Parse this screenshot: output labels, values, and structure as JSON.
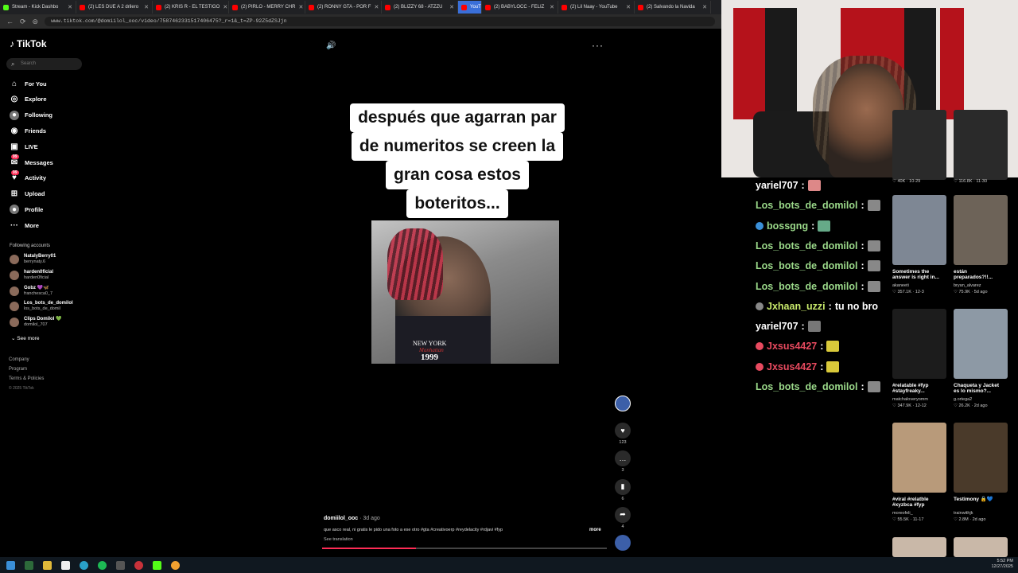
{
  "browser": {
    "tabs": [
      {
        "label": "Stream - Kick Dashbo",
        "color": "#53fc18"
      },
      {
        "label": "(2) LES DUE A 2 drilero",
        "color": "#ff0000"
      },
      {
        "label": "(2) KRIS R - EL TESTIGO",
        "color": "#ff0000"
      },
      {
        "label": "(2) PIRLO - MERRY CHR",
        "color": "#ff0000"
      },
      {
        "label": "(2) RONNY GTA - POR F",
        "color": "#ff0000"
      },
      {
        "label": "(2) BLIZZY 68 - ATZZU",
        "color": "#ff0000"
      },
      {
        "label": "YouTube",
        "color": "#ff0000"
      },
      {
        "label": "(2) BABYLOCC - FELIZ",
        "color": "#ff0000"
      },
      {
        "label": "(2) Lil Naay - YouTube",
        "color": "#ff0000"
      },
      {
        "label": "(2) Salvando la Navida",
        "color": "#ff0000"
      }
    ],
    "url": "www.tiktok.com/@domiilol_ooc/video/7587462331517406475?_r=1&_t=ZP-92Z5dZSJjn"
  },
  "tiktok": {
    "logo": "TikTok",
    "search_placeholder": "Search",
    "nav": [
      {
        "label": "For You",
        "icon": "home-icon"
      },
      {
        "label": "Explore",
        "icon": "compass-icon"
      },
      {
        "label": "Following",
        "icon": "following-icon"
      },
      {
        "label": "Friends",
        "icon": "friends-icon"
      },
      {
        "label": "LIVE",
        "icon": "live-icon"
      },
      {
        "label": "Messages",
        "icon": "messages-icon",
        "badge": "99"
      },
      {
        "label": "Activity",
        "icon": "activity-icon",
        "badge": "99"
      },
      {
        "label": "Upload",
        "icon": "upload-icon"
      },
      {
        "label": "Profile",
        "icon": "profile-icon"
      },
      {
        "label": "More",
        "icon": "more-icon"
      }
    ],
    "following_title": "Following accounts",
    "following": [
      {
        "name": "NatalyBerry01",
        "handle": "berrynaty.6"
      },
      {
        "name": "harden0ficial",
        "handle": "harden0ficial"
      },
      {
        "name": "Gobz 💜🦋",
        "handle": "franchesca0_7"
      },
      {
        "name": "Los_bots_de_domilol",
        "handle": "los_bots_de_domil"
      },
      {
        "name": "Clips Domilol 💚",
        "handle": "domilol_707"
      }
    ],
    "see_more": "See more",
    "footer": [
      "Company",
      "Program",
      "Terms & Policies",
      "© 2025 TikTok"
    ]
  },
  "video": {
    "caption_lines": [
      "después que agarran par",
      "de numeritos se creen la",
      "gran cosa estos",
      "boteritos..."
    ],
    "shirt_text_1": "NEW YORK",
    "shirt_text_2": "Manhattan",
    "shirt_text_3": "1999",
    "author": "domiilol_ooc",
    "date": "· 3d ago",
    "description": "que asco real, ni gratis le pido una foto a ese otro #gta #creativoerp #reydelacity #rdjavi #fyp",
    "more": "more",
    "see_translation": "See translation",
    "progress": 0.33,
    "actions": [
      {
        "icon": "heart-icon",
        "count": "123"
      },
      {
        "icon": "comment-icon",
        "count": "3"
      },
      {
        "icon": "bookmark-icon",
        "count": "6"
      },
      {
        "icon": "share-icon",
        "count": "4"
      }
    ]
  },
  "chat": [
    {
      "user": "yariel707",
      "color": "#ffffff",
      "body": "",
      "emote": "#d88"
    },
    {
      "user": "Los_bots_de_domilol",
      "color": "#9bd98a",
      "body": "",
      "emote": "#888"
    },
    {
      "user": "bossgng",
      "color": "#9bd98a",
      "body": "",
      "emote": "#6a8",
      "pre": "#3a8fd8"
    },
    {
      "user": "Los_bots_de_domilol",
      "color": "#9bd98a",
      "body": "",
      "emote": "#888"
    },
    {
      "user": "Los_bots_de_domilol",
      "color": "#9bd98a",
      "body": "",
      "emote": "#888"
    },
    {
      "user": "Los_bots_de_domilol",
      "color": "#9bd98a",
      "body": "",
      "emote": "#888"
    },
    {
      "user": "Jxhaan_uzzi",
      "color": "#c7e86b",
      "body": "tu no bro",
      "emote": "",
      "pre": "#888"
    },
    {
      "user": "yariel707",
      "color": "#ffffff",
      "body": "",
      "emote": "#777"
    },
    {
      "user": "Jxsus4427",
      "color": "#e84a5f",
      "body": "",
      "emote": "#d9c93a",
      "pre": "#e84a5f"
    },
    {
      "user": "Jxsus4427",
      "color": "#e84a5f",
      "body": "",
      "emote": "#d9c93a",
      "pre": "#e84a5f"
    },
    {
      "user": "Los_bots_de_domilol",
      "color": "#9bd98a",
      "body": "",
      "emote": "#888"
    }
  ],
  "recs": [
    {
      "title": "",
      "user": "",
      "stat": "♡ 40K · 10-29",
      "color": "#2a2a2a"
    },
    {
      "title": "",
      "user": "",
      "stat": "♡ 116.8K · 11-30",
      "color": "#2a2a2a"
    },
    {
      "title": "Sometimes the answer is right in...",
      "user": "akaneeti",
      "stat": "♡ 357.1K · 12-3",
      "color": "#7e8794"
    },
    {
      "title": "están preparados?!!...",
      "user": "bryan_alvarez",
      "stat": "♡ 75.9K · 5d ago",
      "color": "#6d6358"
    },
    {
      "title": "#relatable #fyp #stayfreaky...",
      "user": "matchaloveryomm",
      "stat": "♡ 347.9K · 12-12",
      "color": "#1c1c1c"
    },
    {
      "title": "Chaqueta y Jacket es lo mismo?...",
      "user": "g.ortega2",
      "stat": "♡ 26.2K · 2d ago",
      "color": "#8d99a5"
    },
    {
      "title": "#viral #relatble #xyzbca #fyp",
      "user": "moreofeli_",
      "stat": "♡ 55.5K · 11-17",
      "color": "#b89a7a"
    },
    {
      "title": "Testimony 🔒💙",
      "user": "trainwithjk",
      "stat": "♡ 2.8M · 2d ago",
      "color": "#4a3a2a"
    }
  ],
  "clock": {
    "time": "5:52 PM",
    "date": "12/27/2025"
  }
}
